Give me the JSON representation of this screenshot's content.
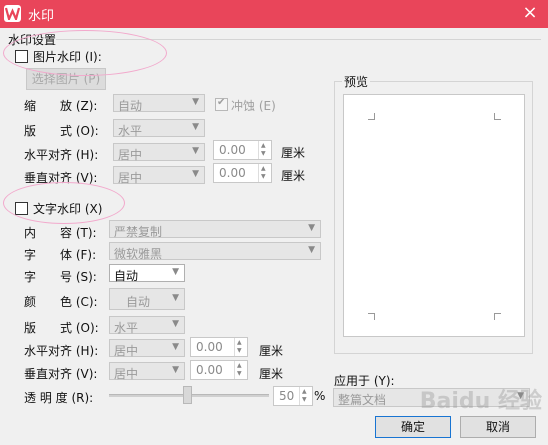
{
  "window": {
    "title": "水印",
    "close_label": "×"
  },
  "section_title": "水印设置",
  "image_watermark": {
    "checkbox_label": "图片水印 (I):",
    "select_image_button": "选择图片 (P)",
    "scale_label": "缩　　放 (Z):",
    "scale_value": "自动",
    "washout_label": "冲蚀 (E)",
    "layout_label": "版　　式 (O):",
    "layout_value": "水平",
    "h_align_label": "水平对齐 (H):",
    "h_align_value": "居中",
    "h_offset": "0.00",
    "h_unit": "厘米",
    "v_align_label": "垂直对齐 (V):",
    "v_align_value": "居中",
    "v_offset": "0.00",
    "v_unit": "厘米"
  },
  "text_watermark": {
    "checkbox_label": "文字水印 (X)",
    "content_label": "内　　容 (T):",
    "content_value": "严禁复制",
    "font_label": "字　　体 (F):",
    "font_value": "微软雅黑",
    "size_label": "字　　号 (S):",
    "size_value": "自动",
    "color_label": "颜　　色 (C):",
    "color_value": "自动",
    "layout_label": "版　　式 (O):",
    "layout_value": "水平",
    "h_align_label": "水平对齐 (H):",
    "h_align_value": "居中",
    "h_offset": "0.00",
    "h_unit": "厘米",
    "v_align_label": "垂直对齐 (V):",
    "v_align_value": "居中",
    "v_offset": "0.00",
    "v_unit": "厘米",
    "transparency_label": "透 明 度 (R):",
    "transparency_value": "50",
    "transparency_unit": "%"
  },
  "preview": {
    "label": "预览"
  },
  "apply_to": {
    "label": "应用于 (Y):",
    "value": "整篇文档"
  },
  "buttons": {
    "ok": "确定",
    "cancel": "取消"
  },
  "overlay_text": "Baidu 经验",
  "colors": {
    "titlebar": "#e9455a",
    "annotation_ellipse": "#f2a9cc",
    "default_button_border": "#1874d2"
  }
}
